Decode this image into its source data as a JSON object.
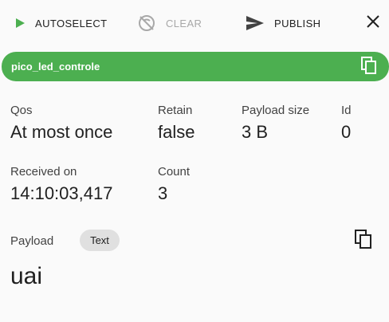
{
  "toolbar": {
    "autoselect_label": "AUTOSELECT",
    "clear_label": "CLEAR",
    "publish_label": "PUBLISH",
    "autoselect_icon": "play-icon",
    "clear_icon": "clear-disabled-icon",
    "publish_icon": "send-icon",
    "close_icon": "close-icon"
  },
  "topic": {
    "name": "pico_led_controle",
    "copy_icon": "copy-icon"
  },
  "details": {
    "qos": {
      "label": "Qos",
      "value": "At most once"
    },
    "retain": {
      "label": "Retain",
      "value": "false"
    },
    "payload_size": {
      "label": "Payload size",
      "value": "3 B"
    },
    "id": {
      "label": "Id",
      "value": "0"
    },
    "received_on": {
      "label": "Received on",
      "value": "14:10:03,417"
    },
    "count": {
      "label": "Count",
      "value": "3"
    }
  },
  "payload": {
    "label": "Payload",
    "format_chip": "Text",
    "value": "uai",
    "copy_icon": "copy-icon"
  },
  "colors": {
    "accent": "#4caf50",
    "disabled": "#a8a8a8",
    "text": "#212121",
    "background": "#fafafa",
    "chip": "#e0e0e0"
  }
}
